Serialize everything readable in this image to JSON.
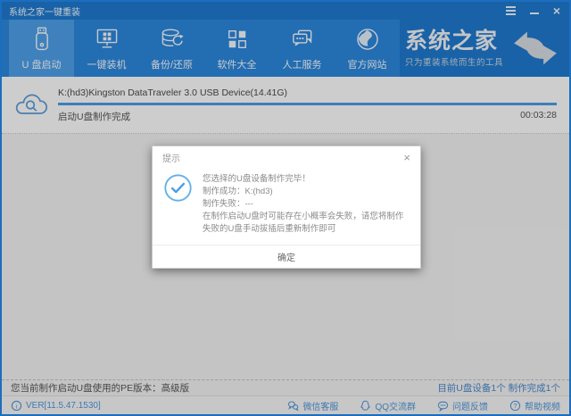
{
  "window": {
    "title": "系统之家一键重装",
    "close_icon": "×"
  },
  "nav": {
    "items": [
      {
        "label": "U 盘启动",
        "icon": "usb-drive-icon",
        "selected": true
      },
      {
        "label": "一键装机",
        "icon": "monitor-icon",
        "selected": false
      },
      {
        "label": "备份/还原",
        "icon": "backup-restore-icon",
        "selected": false
      },
      {
        "label": "软件大全",
        "icon": "apps-grid-icon",
        "selected": false
      },
      {
        "label": "人工服务",
        "icon": "chat-service-icon",
        "selected": false
      },
      {
        "label": "官方网站",
        "icon": "globe-icon",
        "selected": false
      }
    ],
    "brand": {
      "name": "系统之家",
      "slogan": "只为重装系统而生的工具",
      "logo_icon": "swap-arrows-icon"
    }
  },
  "progress": {
    "device": "K:(hd3)Kingston DataTraveler 3.0 USB Device(14.41G)",
    "status": "启动U盘制作完成",
    "elapsed": "00:03:28",
    "percent": 100,
    "icon": "cloud-search-icon"
  },
  "dialog": {
    "title": "提示",
    "close_icon": "×",
    "icon": "check-circle-icon",
    "lines": [
      "您选择的U盘设备制作完毕！",
      "制作成功：K:(hd3)",
      "制作失败：---",
      "在制作启动U盘时可能存在小概率会失败，请您将制作失败的U盘手动拔插后重新制作即可"
    ],
    "ok_label": "确定"
  },
  "statusbar": {
    "left": "您当前制作启动U盘使用的PE版本：高级版",
    "right": "目前U盘设备1个 制作完成1个"
  },
  "footer": {
    "version": "VER[11.5.47.1530]",
    "links": [
      {
        "label": "微信客服",
        "icon": "wechat-icon"
      },
      {
        "label": "QQ交流群",
        "icon": "qq-icon"
      },
      {
        "label": "问题反馈",
        "icon": "feedback-icon"
      },
      {
        "label": "帮助视频",
        "icon": "help-icon"
      }
    ]
  },
  "colors": {
    "titlebar": "#1f78cc",
    "nav": "#2b86d9",
    "nav_selected": "#4d9ee6",
    "progress_fill": "#4a9ae6",
    "link_blue": "#4f94d8",
    "check_blue": "#55a9e8"
  }
}
